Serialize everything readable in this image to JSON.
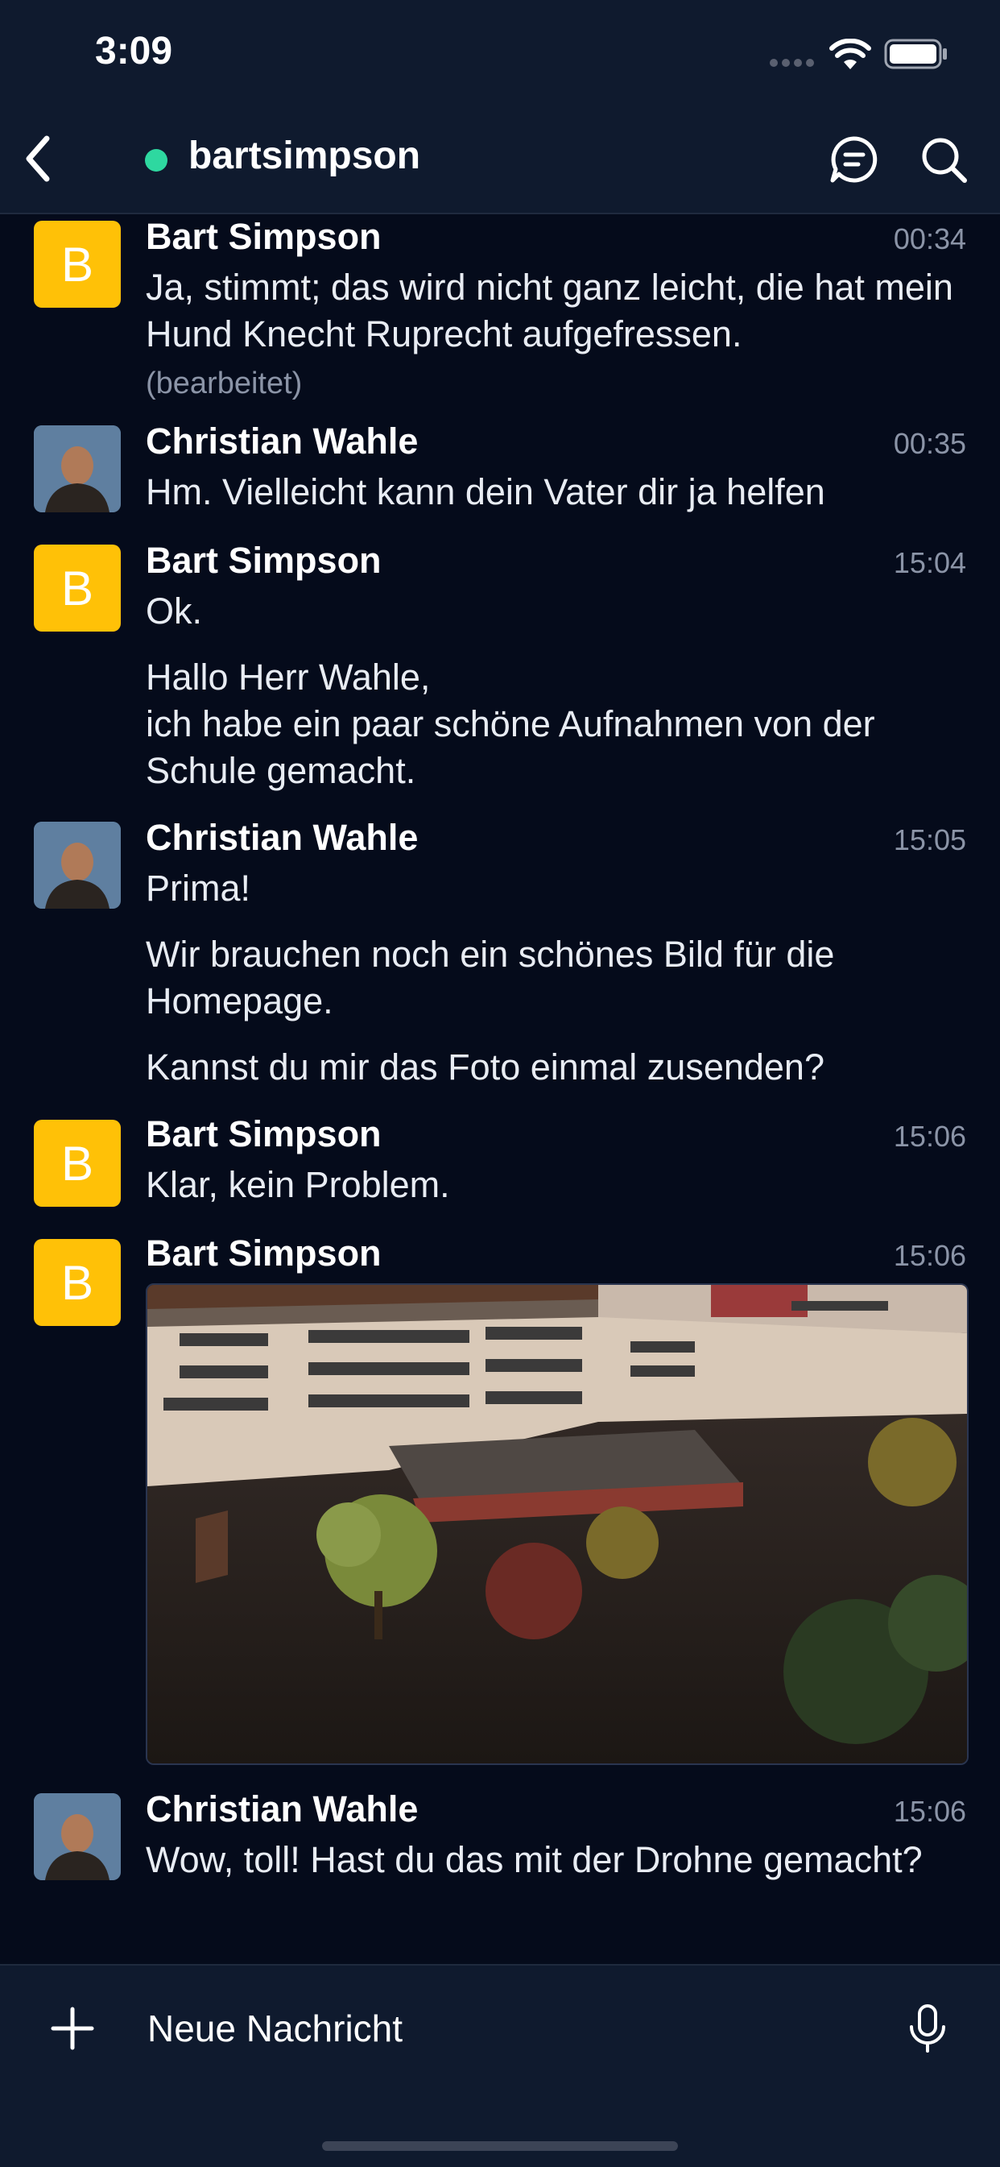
{
  "status_bar": {
    "time": "3:09"
  },
  "header": {
    "title": "bartsimpson"
  },
  "messages": [
    {
      "sender": "Bart Simpson",
      "avatar": "B",
      "time": "00:34",
      "text": "Ja, stimmt; das wird nicht ganz leicht, die hat mein Hund Knecht Ruprecht aufgefressen.",
      "edited": "(bearbeitet)"
    },
    {
      "sender": "Christian Wahle",
      "time": "00:35",
      "text": "Hm. Vielleicht kann dein Vater dir ja helfen"
    },
    {
      "sender": "Bart Simpson",
      "avatar": "B",
      "time": "15:04",
      "text": "Ok.",
      "text2": "Hallo Herr Wahle,\nich habe ein paar schöne Aufnahmen von der Schule gemacht."
    },
    {
      "sender": "Christian Wahle",
      "time": "15:05",
      "text": "Prima!",
      "text2": "Wir brauchen noch ein schönes Bild für die Homepage.",
      "text3": "Kannst du mir das Foto einmal zusenden?"
    },
    {
      "sender": "Bart Simpson",
      "avatar": "B",
      "time": "15:06",
      "text": "Klar, kein Problem."
    },
    {
      "sender": "Bart Simpson",
      "avatar": "B",
      "time": "15:06"
    },
    {
      "sender": "Christian Wahle",
      "time": "15:06",
      "text": "Wow, toll! Hast du das mit der Drohne gemacht?"
    }
  ],
  "composer": {
    "placeholder": "Neue Nachricht"
  },
  "colors": {
    "background": "#050b1b",
    "bar": "#0f1a2e",
    "avatar_yellow": "#ffc107",
    "online": "#2ed8a0"
  }
}
